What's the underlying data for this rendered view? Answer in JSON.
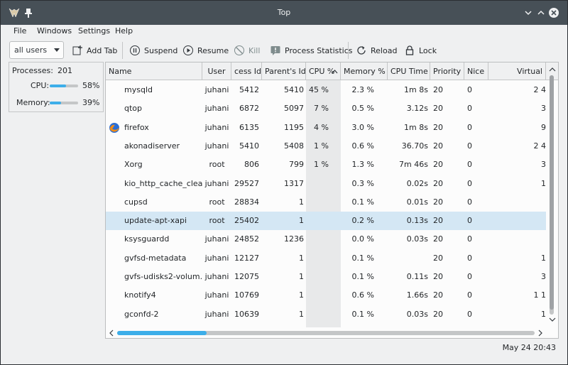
{
  "window": {
    "title": "Top"
  },
  "menu": [
    "File",
    "Windows",
    "Settings",
    "Help"
  ],
  "toolbar": {
    "user_filter": "all users",
    "add_tab": "Add Tab",
    "suspend": "Suspend",
    "resume": "Resume",
    "kill": "Kill",
    "process_statistics": "Process Statistics",
    "reload": "Reload",
    "lock": "Lock"
  },
  "summary": {
    "processes_label": "Processes:",
    "processes_value": "201",
    "cpu_label": "CPU:",
    "cpu_value": "58%",
    "cpu_fraction": 0.58,
    "memory_label": "Memory:",
    "memory_value": "39%",
    "memory_fraction": 0.39
  },
  "table": {
    "columns": [
      "Name",
      "User",
      "cess Id",
      "Parent's Id",
      "CPU %",
      "Memory %",
      "CPU Time",
      "Priority",
      "Nice",
      "Virtual"
    ],
    "sort_column": "CPU %",
    "selected_row": 7,
    "rows": [
      {
        "name": "mysqld",
        "user": "juhani",
        "pid": "5412",
        "ppid": "5410",
        "cpu": "45 %",
        "mem": "2.3 %",
        "time": "1m 8s",
        "prio": "20",
        "nice": "0",
        "virt": "2 4",
        "icon": ""
      },
      {
        "name": "qtop",
        "user": "juhani",
        "pid": "6872",
        "ppid": "5097",
        "cpu": "7 %",
        "mem": "0.5 %",
        "time": "3.12s",
        "prio": "20",
        "nice": "0",
        "virt": "3",
        "icon": ""
      },
      {
        "name": "firefox",
        "user": "juhani",
        "pid": "6135",
        "ppid": "1195",
        "cpu": "4 %",
        "mem": "3.0 %",
        "time": "1m 8s",
        "prio": "20",
        "nice": "0",
        "virt": "9",
        "icon": "firefox-icon"
      },
      {
        "name": "akonadiserver",
        "user": "juhani",
        "pid": "5410",
        "ppid": "5408",
        "cpu": "1 %",
        "mem": "0.6 %",
        "time": "36.70s",
        "prio": "20",
        "nice": "0",
        "virt": "2 4",
        "icon": ""
      },
      {
        "name": "Xorg",
        "user": "root",
        "pid": "806",
        "ppid": "799",
        "cpu": "1 %",
        "mem": "1.3 %",
        "time": "7m 46s",
        "prio": "20",
        "nice": "0",
        "virt": "3",
        "icon": ""
      },
      {
        "name": "kio_http_cache_clean...",
        "user": "juhani",
        "pid": "29527",
        "ppid": "1317",
        "cpu": "",
        "mem": "0.3 %",
        "time": "0.02s",
        "prio": "20",
        "nice": "0",
        "virt": "1",
        "icon": ""
      },
      {
        "name": "cupsd",
        "user": "root",
        "pid": "28834",
        "ppid": "1",
        "cpu": "",
        "mem": "0.1 %",
        "time": "0.01s",
        "prio": "20",
        "nice": "0",
        "virt": "",
        "icon": ""
      },
      {
        "name": "update-apt-xapi",
        "user": "root",
        "pid": "25402",
        "ppid": "1",
        "cpu": "",
        "mem": "0.2 %",
        "time": "0.13s",
        "prio": "20",
        "nice": "0",
        "virt": "",
        "icon": ""
      },
      {
        "name": "ksysguardd",
        "user": "juhani",
        "pid": "24852",
        "ppid": "1236",
        "cpu": "",
        "mem": "0.0 %",
        "time": "0.03s",
        "prio": "20",
        "nice": "0",
        "virt": "",
        "icon": ""
      },
      {
        "name": "gvfsd-metadata",
        "user": "juhani",
        "pid": "12127",
        "ppid": "1",
        "cpu": "",
        "mem": "0.1 %",
        "time": "",
        "prio": "20",
        "nice": "0",
        "virt": "1",
        "icon": ""
      },
      {
        "name": "gvfs-udisks2-volum...",
        "user": "juhani",
        "pid": "12075",
        "ppid": "1",
        "cpu": "",
        "mem": "0.1 %",
        "time": "0.11s",
        "prio": "20",
        "nice": "0",
        "virt": "3",
        "icon": ""
      },
      {
        "name": "knotify4",
        "user": "juhani",
        "pid": "10769",
        "ppid": "1",
        "cpu": "",
        "mem": "0.6 %",
        "time": "1.66s",
        "prio": "20",
        "nice": "0",
        "virt": "1 1",
        "icon": ""
      },
      {
        "name": "gconfd-2",
        "user": "juhani",
        "pid": "10639",
        "ppid": "1",
        "cpu": "",
        "mem": "0.1 %",
        "time": "0.03s",
        "prio": "20",
        "nice": "0",
        "virt": "1",
        "icon": ""
      }
    ]
  },
  "statusbar": {
    "datetime": "May 24 20:43"
  },
  "colors": {
    "accent": "#3daee9",
    "titlebar": "#475057",
    "selection": "#d4e7f4"
  }
}
